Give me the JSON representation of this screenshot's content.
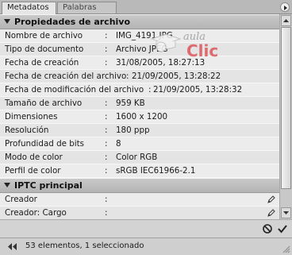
{
  "tabs": [
    {
      "label": "Metadatos",
      "active": true
    },
    {
      "label": "Palabras clave",
      "active": false
    }
  ],
  "sections": [
    {
      "title": "Propiedades de archivo",
      "rows": [
        {
          "label": "Nombre de archivo",
          "value": "IMG_4191.JPG"
        },
        {
          "label": "Tipo de documento",
          "value": "Archivo JPEG"
        },
        {
          "label": "Fecha de creación",
          "value": "31/08/2005, 18:27:13"
        },
        {
          "label": "Fecha de creación del archivo",
          "value": "21/09/2005, 13:28:22"
        },
        {
          "label": "Fecha de modificación del archivo",
          "value": "21/09/2005, 13:28:32"
        },
        {
          "label": "Tamaño de archivo",
          "value": "959 KB"
        },
        {
          "label": "Dimensiones",
          "value": "1600 x 1200"
        },
        {
          "label": "Resolución",
          "value": "180 ppp"
        },
        {
          "label": "Profundidad de bits",
          "value": "8"
        },
        {
          "label": "Modo de color",
          "value": "Color RGB"
        },
        {
          "label": "Perfil de color",
          "value": "sRGB IEC61966-2.1"
        }
      ]
    },
    {
      "title": "IPTC principal",
      "rows": [
        {
          "label": "Creador",
          "value": ""
        },
        {
          "label": "Creador: Cargo",
          "value": ""
        }
      ]
    }
  ],
  "watermark": {
    "top": "aula",
    "bottom": "Clic"
  },
  "status": {
    "text": "53 elementos, 1 seleccionado"
  },
  "colors": {
    "panel": "#d6d6d6",
    "header": "#bdbdbd",
    "logo_red": "#d8262b"
  }
}
